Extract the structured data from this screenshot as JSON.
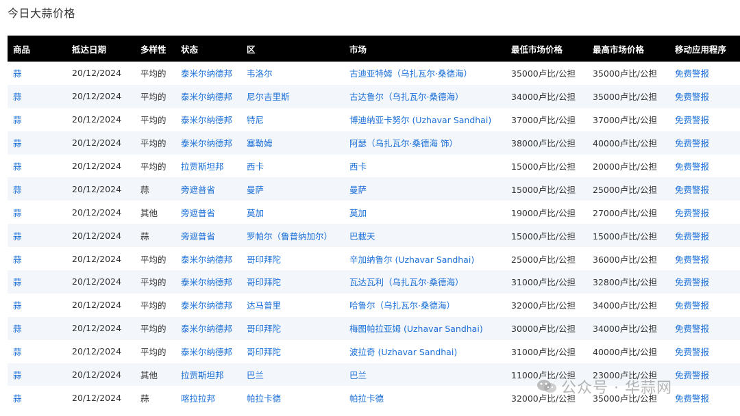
{
  "page_title": "今日大蒜价格",
  "colors": {
    "header_bg": "#000000",
    "link": "#1a6fd8",
    "row_alt": "#f3f6fa"
  },
  "columns": [
    "商品",
    "抵达日期",
    "多样性",
    "状态",
    "区",
    "市场",
    "最低市场价格",
    "最高市场价格",
    "移动应用程序"
  ],
  "rows": [
    [
      "蒜",
      "20/12/2024",
      "平均的",
      "泰米尔纳德邦",
      "韦洛尔",
      "古迪亚特姆（乌扎瓦尔·桑德海）",
      "35000卢比/公担",
      "35000卢比/公担",
      "免费警报"
    ],
    [
      "蒜",
      "20/12/2024",
      "平均的",
      "泰米尔纳德邦",
      "尼尔吉里斯",
      "古达鲁尔（乌扎瓦尔·桑德海）",
      "34000卢比/公担",
      "35000卢比/公担",
      "免费警报"
    ],
    [
      "蒜",
      "20/12/2024",
      "平均的",
      "泰米尔纳德邦",
      "特尼",
      "博迪纳亚卡努尔 (Uzhavar Sandhai)",
      "37000卢比/公担",
      "37000卢比/公担",
      "免费警报"
    ],
    [
      "蒜",
      "20/12/2024",
      "平均的",
      "泰米尔纳德邦",
      "塞勒姆",
      "阿瑟（乌扎瓦尔·桑德海 饰）",
      "38000卢比/公担",
      "40000卢比/公担",
      "免费警报"
    ],
    [
      "蒜",
      "20/12/2024",
      "平均的",
      "拉贾斯坦邦",
      "西卡",
      "西卡",
      "15000卢比/公担",
      "20000卢比/公担",
      "免费警报"
    ],
    [
      "蒜",
      "20/12/2024",
      "蒜",
      "旁遮普省",
      "曼萨",
      "曼萨",
      "15000卢比/公担",
      "25000卢比/公担",
      "免费警报"
    ],
    [
      "蒜",
      "20/12/2024",
      "其他",
      "旁遮普省",
      "莫加",
      "莫加",
      "19000卢比/公担",
      "27000卢比/公担",
      "免费警报"
    ],
    [
      "蒜",
      "20/12/2024",
      "蒜",
      "旁遮普省",
      "罗帕尔（鲁普纳加尔）",
      "巴載天",
      "15000卢比/公担",
      "15000卢比/公担",
      "免费警报"
    ],
    [
      "蒜",
      "20/12/2024",
      "平均的",
      "泰米尔纳德邦",
      "哥印拜陀",
      "辛加纳鲁尔 (Uzhavar Sandhai)",
      "25000卢比/公担",
      "36000卢比/公担",
      "免费警报"
    ],
    [
      "蒜",
      "20/12/2024",
      "平均的",
      "泰米尔纳德邦",
      "哥印拜陀",
      "瓦达瓦利（乌扎瓦尔·桑德海）",
      "31000卢比/公担",
      "32800卢比/公担",
      "免费警报"
    ],
    [
      "蒜",
      "20/12/2024",
      "平均的",
      "泰米尔纳德邦",
      "达马普里",
      "哈鲁尔（乌扎瓦尔·桑德海）",
      "32000卢比/公担",
      "34000卢比/公担",
      "免费警报"
    ],
    [
      "蒜",
      "20/12/2024",
      "平均的",
      "泰米尔纳德邦",
      "哥印拜陀",
      "梅图帕拉亚姆 (Uzhavar Sandhai)",
      "30000卢比/公担",
      "34000卢比/公担",
      "免费警报"
    ],
    [
      "蒜",
      "20/12/2024",
      "平均的",
      "泰米尔纳德邦",
      "哥印拜陀",
      "波拉奇 (Uzhavar Sandhai)",
      "31000卢比/公担",
      "40000卢比/公担",
      "免费警报"
    ],
    [
      "蒜",
      "20/12/2024",
      "其他",
      "拉贾斯坦邦",
      "巴兰",
      "巴兰",
      "11000卢比/公担",
      "23000卢比/公担",
      "免费警报"
    ],
    [
      "蒜",
      "20/12/2024",
      "蒜",
      "喀拉拉邦",
      "帕拉卡德",
      "帕拉卡德",
      "32000卢比/公担",
      "35000卢比/公担",
      "免费警报"
    ]
  ],
  "watermark": {
    "text": "公众号 · 华蒜网",
    "icon": "wechat-icon"
  }
}
